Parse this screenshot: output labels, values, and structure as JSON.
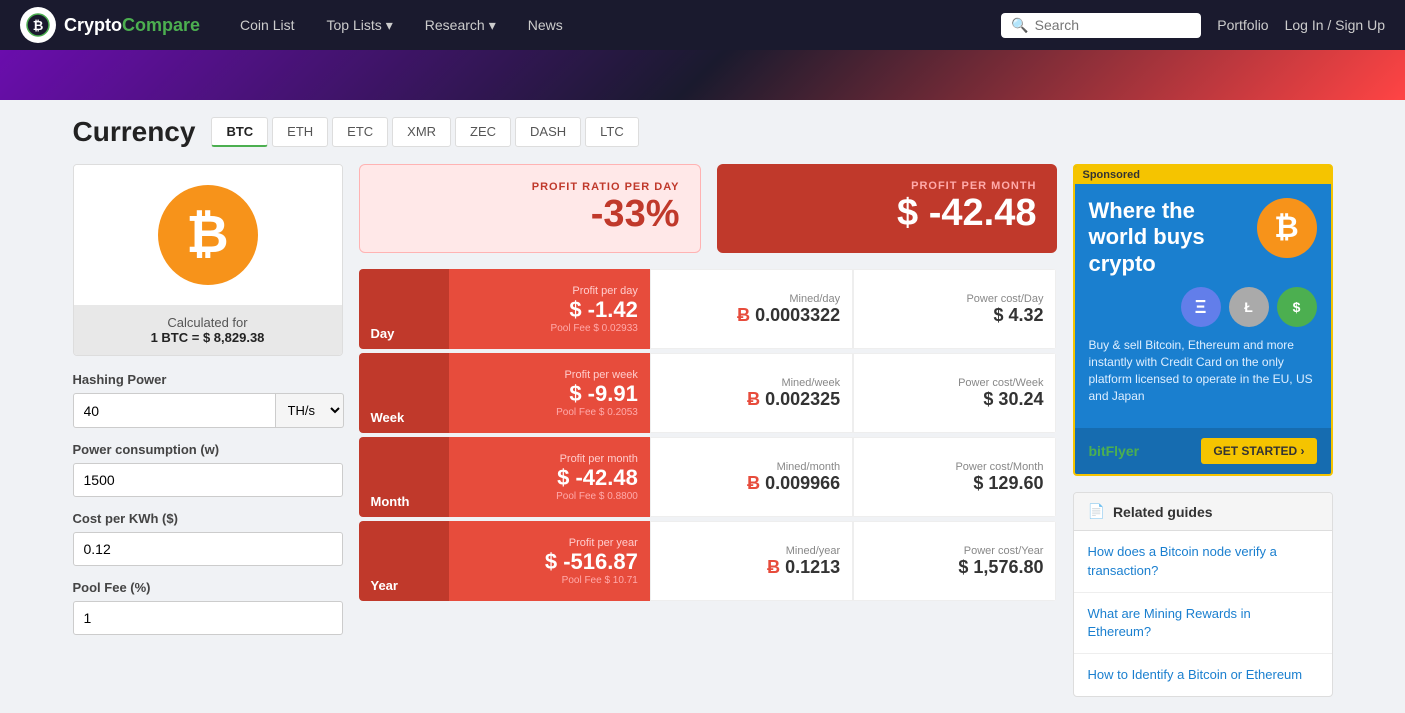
{
  "nav": {
    "logo_crypto": "Crypto",
    "logo_compare": "Compare",
    "links": [
      {
        "label": "Coin List",
        "has_arrow": false
      },
      {
        "label": "Top Lists",
        "has_arrow": true
      },
      {
        "label": "Research",
        "has_arrow": true
      },
      {
        "label": "News",
        "has_arrow": false
      }
    ],
    "search_placeholder": "Search",
    "portfolio_label": "Portfolio",
    "login_label": "Log In / Sign Up"
  },
  "currency": {
    "title": "Currency",
    "tabs": [
      "BTC",
      "ETH",
      "ETC",
      "XMR",
      "ZEC",
      "DASH",
      "LTC"
    ],
    "active_tab": "BTC",
    "calculated_for": "Calculated for",
    "btc_price": "1 BTC = $ 8,829.38",
    "btc_symbol": "₿"
  },
  "inputs": {
    "hashing_power_label": "Hashing Power",
    "hashing_power_value": "40",
    "hashing_unit": "TH/s",
    "power_consumption_label": "Power consumption (w)",
    "power_consumption_value": "1500",
    "cost_per_kwh_label": "Cost per KWh ($)",
    "cost_per_kwh_value": "0.12",
    "pool_fee_label": "Pool Fee (%)",
    "pool_fee_value": "1"
  },
  "profit_summary": {
    "ratio_label": "PROFIT RATIO PER DAY",
    "ratio_value": "-33%",
    "month_label": "PROFIT PER MONTH",
    "month_value": "$ -42.48"
  },
  "mining_rows": [
    {
      "period": "Day",
      "profit_label": "Profit per day",
      "profit_value": "$ -1.42",
      "pool_fee": "Pool Fee $ 0.02933",
      "mined_label": "Mined/day",
      "mined_value": "0.0003322",
      "power_label": "Power cost/Day",
      "power_value": "$ 4.32"
    },
    {
      "period": "Week",
      "profit_label": "Profit per week",
      "profit_value": "$ -9.91",
      "pool_fee": "Pool Fee $ 0.2053",
      "mined_label": "Mined/week",
      "mined_value": "0.002325",
      "power_label": "Power cost/Week",
      "power_value": "$ 30.24"
    },
    {
      "period": "Month",
      "profit_label": "Profit per month",
      "profit_value": "$ -42.48",
      "pool_fee": "Pool Fee $ 0.8800",
      "mined_label": "Mined/month",
      "mined_value": "0.009966",
      "power_label": "Power cost/Month",
      "power_value": "$ 129.60"
    },
    {
      "period": "Year",
      "profit_label": "Profit per year",
      "profit_value": "$ -516.87",
      "pool_fee": "Pool Fee $ 10.71",
      "mined_label": "Mined/year",
      "mined_value": "0.1213",
      "power_label": "Power cost/Year",
      "power_value": "$ 1,576.80"
    }
  ],
  "ad": {
    "sponsored": "Sponsored",
    "headline": "Where the world buys crypto",
    "body_text": "Buy & sell Bitcoin, Ethereum and more instantly with Credit Card on the only platform licensed to operate in the EU, US and Japan",
    "logo": "bitFlyer",
    "cta": "GET STARTED ›"
  },
  "related_guides": {
    "header": "Related guides",
    "items": [
      "How does a Bitcoin node verify a transaction?",
      "What are Mining Rewards in Ethereum?",
      "How to Identify a Bitcoin or Ethereum"
    ]
  }
}
